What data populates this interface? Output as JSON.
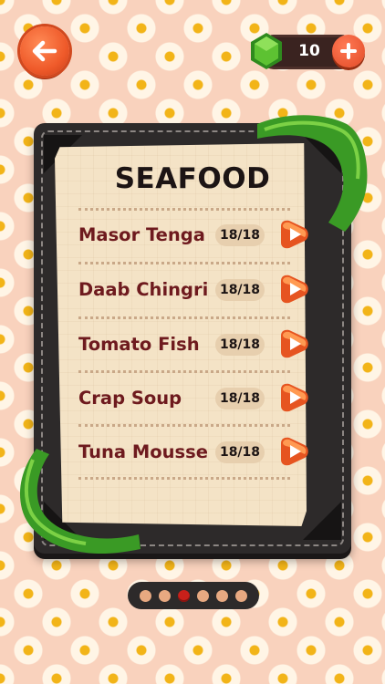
{
  "header": {
    "back_icon": "arrow-left-icon",
    "currency_icon": "green-gem-icon",
    "currency_count": "10",
    "add_icon": "plus-icon"
  },
  "menu": {
    "title": "SEAFOOD",
    "items": [
      {
        "name": "Masor Tenga",
        "progress": "18/18"
      },
      {
        "name": "Daab Chingri",
        "progress": "18/18"
      },
      {
        "name": "Tomato Fish",
        "progress": "18/18"
      },
      {
        "name": "Crap Soup",
        "progress": "18/18"
      },
      {
        "name": "Tuna Mousse",
        "progress": "18/18"
      }
    ]
  },
  "pager": {
    "page_count": 6,
    "active_page": 3
  },
  "colors": {
    "background": "#f9d2bd",
    "board": "#2d2a2a",
    "paper": "#f4e3c6",
    "dish_text": "#6e1a1e",
    "accent_orange": "#ef5a2a",
    "ribbon_green": "#3a9a25"
  }
}
